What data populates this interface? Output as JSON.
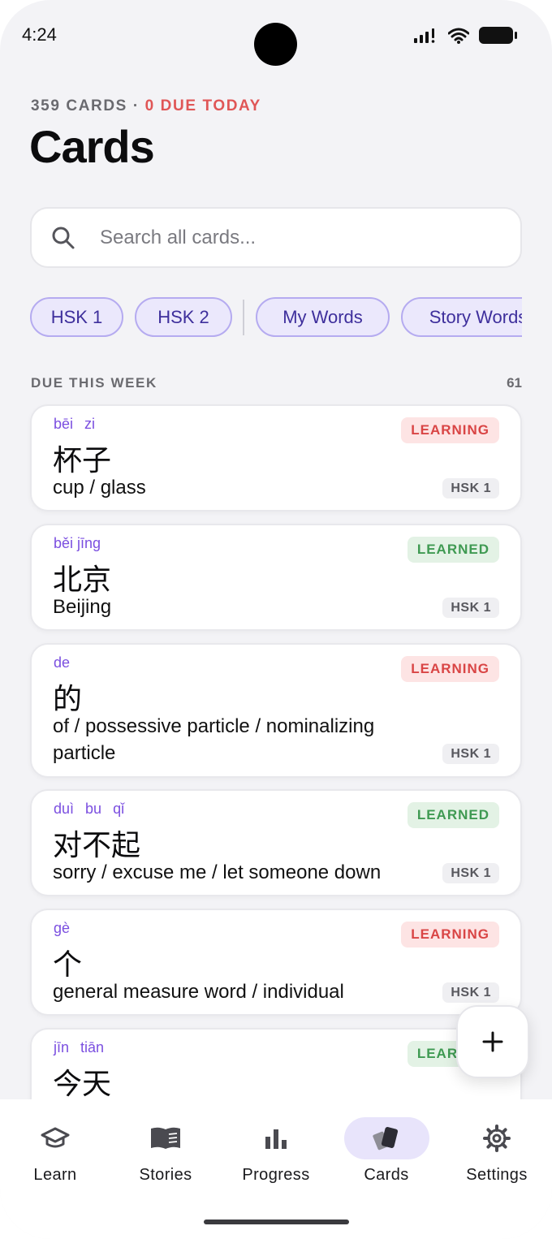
{
  "status_bar": {
    "time": "4:24"
  },
  "header": {
    "card_count": "359 CARDS",
    "separator": " · ",
    "due_today": "0 DUE TODAY",
    "title": "Cards"
  },
  "search": {
    "placeholder": "Search all cards..."
  },
  "filters": [
    {
      "label": "HSK 1"
    },
    {
      "label": "HSK 2"
    },
    {
      "label": "My Words"
    },
    {
      "label": "Story Words"
    }
  ],
  "section": {
    "title": "DUE THIS WEEK",
    "count": "61"
  },
  "cards": [
    {
      "pinyin": [
        "bēi",
        "zi"
      ],
      "hanzi": "杯子",
      "meaning": "cup / glass",
      "status": "LEARNING",
      "level": "HSK 1"
    },
    {
      "pinyin": [
        "běi jīng"
      ],
      "hanzi": "北京",
      "meaning": "Beijing",
      "status": "LEARNED",
      "level": "HSK 1"
    },
    {
      "pinyin": [
        "de"
      ],
      "hanzi": "的",
      "meaning": "of / possessive particle / nominalizing particle",
      "status": "LEARNING",
      "level": "HSK 1"
    },
    {
      "pinyin": [
        "duì",
        "bu",
        "qǐ"
      ],
      "hanzi": "对不起",
      "meaning": "sorry / excuse me / let someone down",
      "status": "LEARNED",
      "level": "HSK 1"
    },
    {
      "pinyin": [
        "gè"
      ],
      "hanzi": "个",
      "meaning": "general measure word / individual",
      "status": "LEARNING",
      "level": "HSK 1"
    },
    {
      "pinyin": [
        "jīn",
        "tiān"
      ],
      "hanzi": "今天",
      "meaning": "",
      "status": "LEARNED",
      "level": ""
    }
  ],
  "fab": {
    "icon": "plus-icon"
  },
  "tabs": [
    {
      "label": "Learn",
      "icon": "graduation-cap-icon"
    },
    {
      "label": "Stories",
      "icon": "book-icon"
    },
    {
      "label": "Progress",
      "icon": "bar-chart-icon"
    },
    {
      "label": "Cards",
      "icon": "cards-icon",
      "active": true
    },
    {
      "label": "Settings",
      "icon": "gear-icon"
    }
  ],
  "colors": {
    "accent": "#7b4fe0",
    "due": "#e05656",
    "learning": "#d94545",
    "learned": "#3f9a52",
    "chip_bg": "#ebe8fc"
  }
}
